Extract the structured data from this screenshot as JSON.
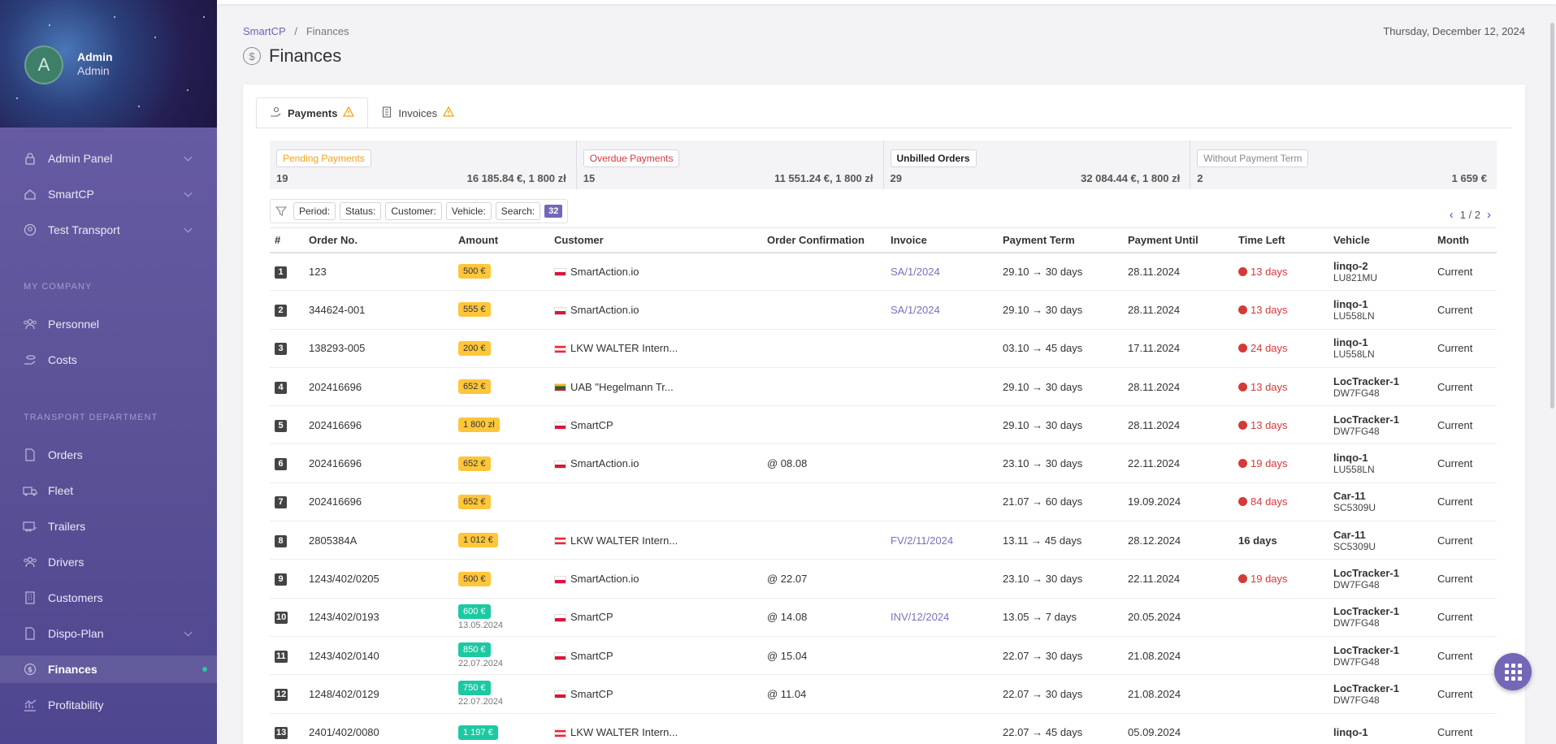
{
  "user": {
    "initial": "A",
    "name": "Admin",
    "role": "Admin"
  },
  "sidebar": {
    "items": [
      {
        "label": "Admin Panel",
        "icon": "lock-icon",
        "has_chevron": true
      },
      {
        "label": "SmartCP",
        "icon": "home-icon",
        "has_chevron": true
      },
      {
        "label": "Test Transport",
        "icon": "user-circle-icon",
        "has_chevron": true
      }
    ],
    "section_company": "MY COMPANY",
    "company_items": [
      {
        "label": "Personnel",
        "icon": "people-icon"
      },
      {
        "label": "Costs",
        "icon": "coins-icon"
      }
    ],
    "section_transport": "TRANSPORT DEPARTMENT",
    "transport_items": [
      {
        "label": "Orders",
        "icon": "document-icon"
      },
      {
        "label": "Fleet",
        "icon": "truck-icon"
      },
      {
        "label": "Trailers",
        "icon": "trailer-icon"
      },
      {
        "label": "Drivers",
        "icon": "drivers-icon"
      },
      {
        "label": "Customers",
        "icon": "building-icon"
      },
      {
        "label": "Dispo-Plan",
        "icon": "calendar-icon",
        "has_chevron": true
      },
      {
        "label": "Finances",
        "icon": "dollar-icon",
        "active": true
      },
      {
        "label": "Profitability",
        "icon": "chart-icon"
      }
    ]
  },
  "breadcrumb": {
    "root": "SmartCP",
    "separator": "/",
    "current": "Finances"
  },
  "date": "Thursday, December 12, 2024",
  "page_title": "Finances",
  "tabs": [
    {
      "label": "Payments",
      "icon": "hand-coin-icon",
      "warning": true,
      "active": true
    },
    {
      "label": "Invoices",
      "icon": "receipt-icon",
      "warning": true
    }
  ],
  "stats": [
    {
      "label": "Pending Payments",
      "count": "19",
      "sum": "16 185.84 €, 1 800 zł",
      "color": "#f3a21b"
    },
    {
      "label": "Overdue Payments",
      "count": "15",
      "sum": "11 551.24 €, 1 800 zł",
      "color": "#d43a3a"
    },
    {
      "label": "Unbilled Orders",
      "count": "29",
      "sum": "32 084.44 €, 1 800 zł",
      "color": "#222222"
    },
    {
      "label": "Without Payment Term",
      "count": "2",
      "sum": "1 659 €",
      "color": "#888888"
    }
  ],
  "filters": {
    "period": "Period:",
    "status": "Status:",
    "customer": "Customer:",
    "vehicle": "Vehicle:",
    "search": "Search:",
    "count": "32"
  },
  "pager": "1 / 2",
  "table": {
    "headers": [
      "#",
      "Order No.",
      "Amount",
      "Customer",
      "Order Confirmation",
      "Invoice",
      "Payment Term",
      "Payment Until",
      "Time Left",
      "Vehicle",
      "Month"
    ],
    "rows": [
      {
        "n": "1",
        "order": "123",
        "amount": "500 €",
        "amount_style": "yellow",
        "amount_date": "",
        "flag": "pl",
        "customer": "SmartAction.io",
        "confirm": "",
        "invoice": "SA/1/2024",
        "term": "29.10 → 30 days",
        "until": "28.11.2024",
        "time_left": "13 days",
        "overdue": true,
        "veh": "linqo-2",
        "plate": "LU821MU",
        "month": "Current"
      },
      {
        "n": "2",
        "order": "344624-001",
        "amount": "555 €",
        "amount_style": "yellow",
        "amount_date": "",
        "flag": "pl",
        "customer": "SmartAction.io",
        "confirm": "",
        "invoice": "SA/1/2024",
        "term": "29.10 → 30 days",
        "until": "28.11.2024",
        "time_left": "13 days",
        "overdue": true,
        "veh": "linqo-1",
        "plate": "LU558LN",
        "month": "Current"
      },
      {
        "n": "3",
        "order": "138293-005",
        "amount": "200 €",
        "amount_style": "yellow",
        "amount_date": "",
        "flag": "at",
        "customer": "LKW WALTER Intern...",
        "confirm": "",
        "invoice": "",
        "term": "03.10 → 45 days",
        "until": "17.11.2024",
        "time_left": "24 days",
        "overdue": true,
        "veh": "linqo-1",
        "plate": "LU558LN",
        "month": "Current"
      },
      {
        "n": "4",
        "order": "202416696",
        "amount": "652 €",
        "amount_style": "yellow",
        "amount_date": "",
        "flag": "lt",
        "customer": "UAB \"Hegelmann Tr...",
        "confirm": "",
        "invoice": "",
        "term": "29.10 → 30 days",
        "until": "28.11.2024",
        "time_left": "13 days",
        "overdue": true,
        "veh": "LocTracker-1",
        "plate": "DW7FG48",
        "month": "Current"
      },
      {
        "n": "5",
        "order": "202416696",
        "amount": "1 800 zł",
        "amount_style": "yellow",
        "amount_date": "",
        "flag": "pl",
        "customer": "SmartCP",
        "confirm": "",
        "invoice": "",
        "term": "29.10 → 30 days",
        "until": "28.11.2024",
        "time_left": "13 days",
        "overdue": true,
        "veh": "LocTracker-1",
        "plate": "DW7FG48",
        "month": "Current"
      },
      {
        "n": "6",
        "order": "202416696",
        "amount": "652 €",
        "amount_style": "yellow",
        "amount_date": "",
        "flag": "pl",
        "customer": "SmartAction.io",
        "confirm": "@ 08.08",
        "invoice": "",
        "term": "23.10 → 30 days",
        "until": "22.11.2024",
        "time_left": "19 days",
        "overdue": true,
        "veh": "linqo-1",
        "plate": "LU558LN",
        "month": "Current"
      },
      {
        "n": "7",
        "order": "202416696",
        "amount": "652 €",
        "amount_style": "yellow",
        "amount_date": "",
        "flag": "",
        "customer": "",
        "confirm": "",
        "invoice": "",
        "term": "21.07 → 60 days",
        "until": "19.09.2024",
        "time_left": "84 days",
        "overdue": true,
        "veh": "Car-11",
        "plate": "SC5309U",
        "month": "Current"
      },
      {
        "n": "8",
        "order": "2805384A",
        "amount": "1 012 €",
        "amount_style": "yellow",
        "amount_date": "",
        "flag": "at",
        "customer": "LKW WALTER Intern...",
        "confirm": "",
        "invoice": "FV/2/11/2024",
        "term": "13.11 → 45 days",
        "until": "28.12.2024",
        "time_left": "16 days",
        "overdue": false,
        "veh": "Car-11",
        "plate": "SC5309U",
        "month": "Current"
      },
      {
        "n": "9",
        "order": "1243/402/0205",
        "amount": "500 €",
        "amount_style": "yellow",
        "amount_date": "",
        "flag": "pl",
        "customer": "SmartAction.io",
        "confirm": "@ 22.07",
        "invoice": "",
        "term": "23.10 → 30 days",
        "until": "22.11.2024",
        "time_left": "19 days",
        "overdue": true,
        "veh": "LocTracker-1",
        "plate": "DW7FG48",
        "month": "Current"
      },
      {
        "n": "10",
        "order": "1243/402/0193",
        "amount": "600 €",
        "amount_style": "green",
        "amount_date": "13.05.2024",
        "flag": "pl",
        "customer": "SmartCP",
        "confirm": "@ 14.08",
        "invoice": "INV/12/2024",
        "term": "13.05 → 7 days",
        "until": "20.05.2024",
        "time_left": "",
        "overdue": false,
        "veh": "LocTracker-1",
        "plate": "DW7FG48",
        "month": "Current"
      },
      {
        "n": "11",
        "order": "1243/402/0140",
        "amount": "850 €",
        "amount_style": "green",
        "amount_date": "22.07.2024",
        "flag": "pl",
        "customer": "SmartCP",
        "confirm": "@ 15.04",
        "invoice": "",
        "term": "22.07 → 30 days",
        "until": "21.08.2024",
        "time_left": "",
        "overdue": false,
        "veh": "LocTracker-1",
        "plate": "DW7FG48",
        "month": "Current"
      },
      {
        "n": "12",
        "order": "1248/402/0129",
        "amount": "750 €",
        "amount_style": "green",
        "amount_date": "22.07.2024",
        "flag": "pl",
        "customer": "SmartCP",
        "confirm": "@ 11.04",
        "invoice": "",
        "term": "22.07 → 30 days",
        "until": "21.08.2024",
        "time_left": "",
        "overdue": false,
        "veh": "LocTracker-1",
        "plate": "DW7FG48",
        "month": "Current"
      },
      {
        "n": "13",
        "order": "2401/402/0080",
        "amount": "1 197 €",
        "amount_style": "green",
        "amount_date": "",
        "flag": "at",
        "customer": "LKW WALTER Intern...",
        "confirm": "",
        "invoice": "",
        "term": "22.07 → 45 days",
        "until": "05.09.2024",
        "time_left": "",
        "overdue": false,
        "veh": "linqo-1",
        "plate": "",
        "month": "Current"
      }
    ]
  },
  "colors": {
    "accent": "#7367b8",
    "warning": "#f3a21b",
    "danger": "#d43a3a",
    "success": "#1cc9a2"
  }
}
